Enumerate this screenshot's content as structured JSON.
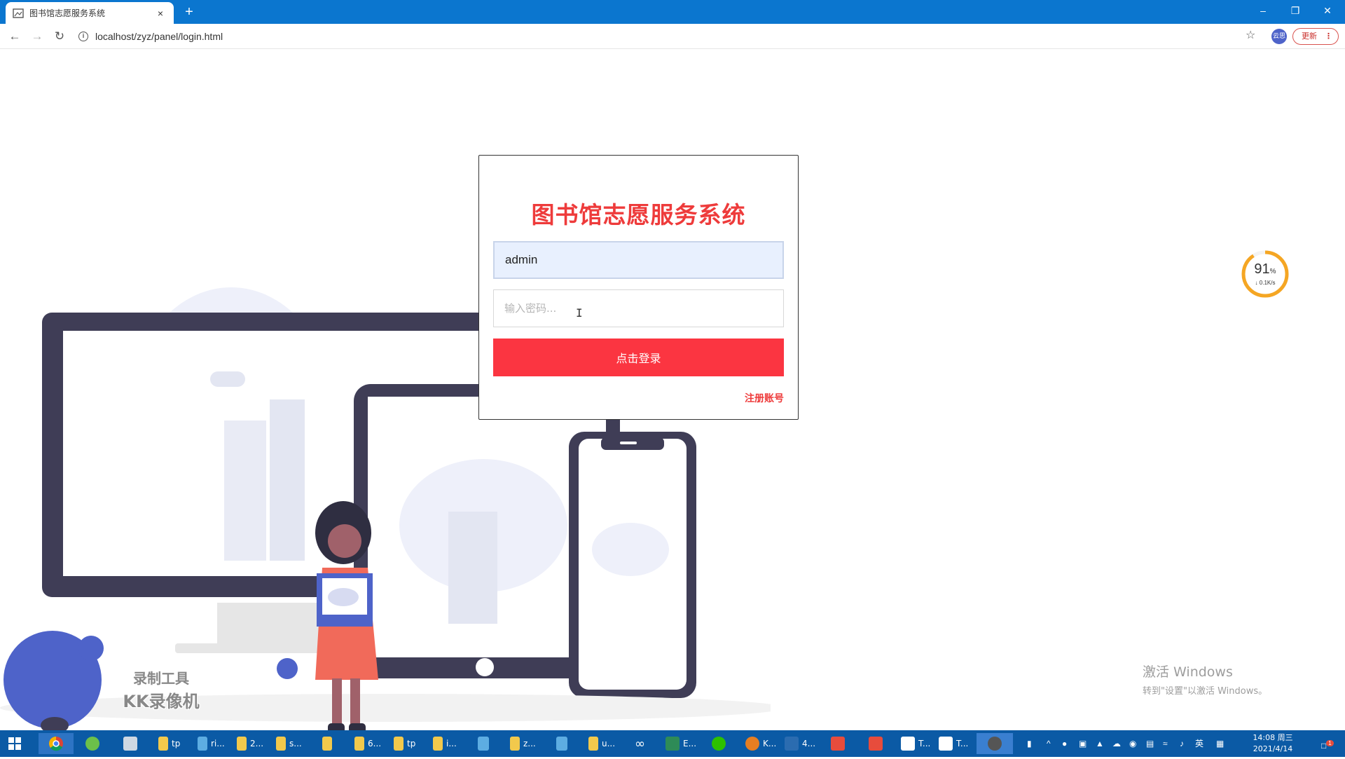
{
  "browser": {
    "tab_title": "图书馆志愿服务系统",
    "tab_close": "×",
    "new_tab": "+",
    "url": "localhost/zyz/panel/login.html",
    "profile_label": "云思",
    "update_label": "更新",
    "window_controls": {
      "minimize": "–",
      "restore": "❐",
      "close": "✕"
    }
  },
  "login": {
    "title": "图书馆志愿服务系统",
    "username_value": "admin",
    "password_placeholder": "输入密码...",
    "submit_label": "点击登录",
    "register_label": "注册账号"
  },
  "speed_widget": {
    "percent": "91",
    "percent_unit": "%",
    "rate": "↓ 0.1K/s",
    "ring_color": "#f5a623"
  },
  "watermark": {
    "line1": "录制工具",
    "line2": "KK录像机"
  },
  "windows_activation": {
    "line1": "激活 Windows",
    "line2": "转到\"设置\"以激活 Windows。"
  },
  "taskbar": {
    "items": [
      {
        "label": "tp",
        "icon": "folder-icon"
      },
      {
        "label": "ri...",
        "icon": "app-icon"
      },
      {
        "label": "2...",
        "icon": "folder-icon"
      },
      {
        "label": "s...",
        "icon": "folder-icon"
      },
      {
        "label": "",
        "icon": "folder-icon"
      },
      {
        "label": "6...",
        "icon": "folder-icon"
      },
      {
        "label": "tp",
        "icon": "folder-icon"
      },
      {
        "label": "i...",
        "icon": "folder-icon"
      },
      {
        "label": "",
        "icon": "app-icon"
      },
      {
        "label": "z...",
        "icon": "folder-icon"
      },
      {
        "label": "",
        "icon": "app-icon"
      },
      {
        "label": "u...",
        "icon": "folder-icon"
      },
      {
        "label": "E...",
        "icon": "app-icon"
      },
      {
        "label": "K...",
        "icon": "app-icon"
      },
      {
        "label": "4...",
        "icon": "app-icon"
      },
      {
        "label": "T...",
        "icon": "app-icon"
      },
      {
        "label": "T...",
        "icon": "app-icon"
      }
    ],
    "ime": "英",
    "time": "14:08 周三",
    "date": "2021/4/14",
    "notification_count": "1"
  },
  "colors": {
    "brand_red": "#ee3b3b",
    "button_red": "#fb3541",
    "titlebar_blue": "#0b76cf",
    "illustration_navy": "#3f3d56",
    "illustration_blue": "#4e63c9"
  }
}
